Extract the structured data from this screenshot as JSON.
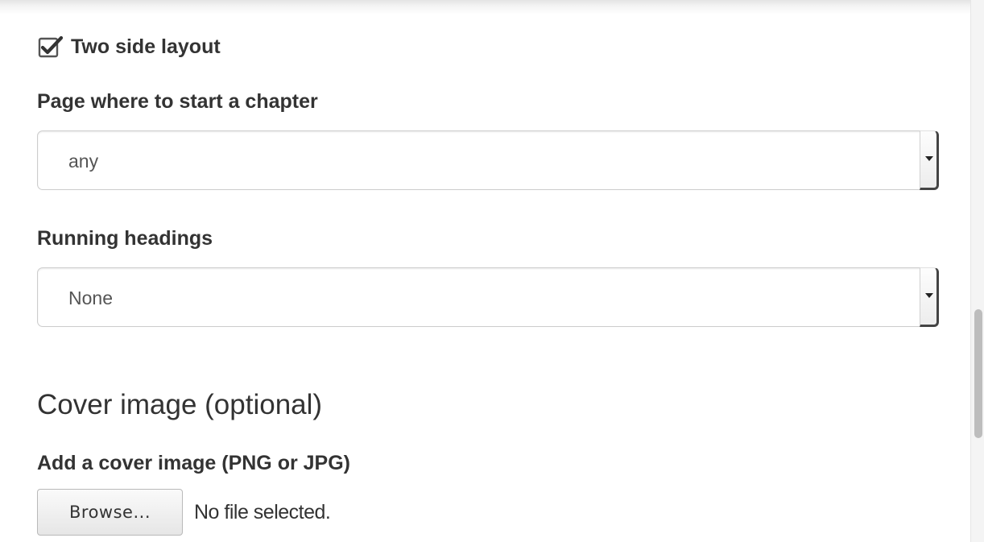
{
  "layout_settings": {
    "two_side_layout": {
      "label": "Two side layout",
      "checked": true
    },
    "chapter_start": {
      "label": "Page where to start a chapter",
      "selected": "any"
    },
    "running_headings": {
      "label": "Running headings",
      "selected": "None"
    }
  },
  "cover": {
    "section_title": "Cover image (optional)",
    "field_label": "Add a cover image (PNG or JPG)",
    "browse_label": "Browse...",
    "file_status": "No file selected."
  },
  "icons": {
    "checkbox": "checkmark-icon",
    "select": "chevron-down-icon"
  },
  "colors": {
    "text": "#333333",
    "border": "#cccccc",
    "scroll_thumb": "#bdbdbd"
  },
  "scroll_position": 0.57
}
